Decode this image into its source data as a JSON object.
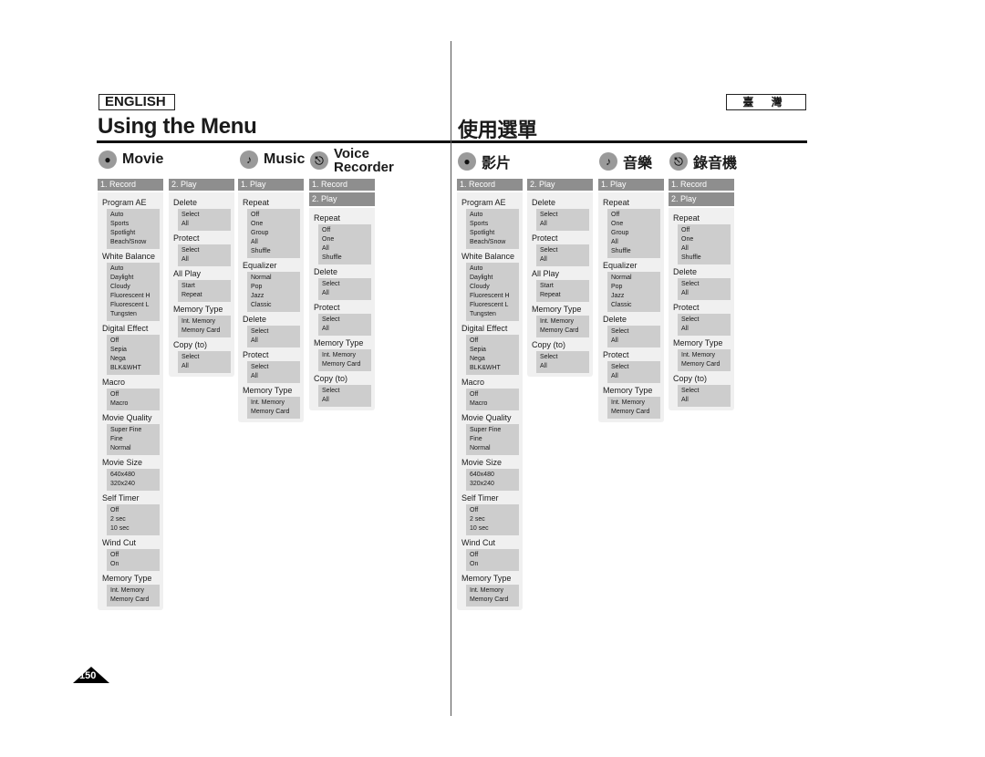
{
  "left": {
    "language_label": "ENGLISH",
    "title": "Using the Menu",
    "categories": [
      {
        "name": "Movie",
        "icon": "camcorder-icon"
      },
      {
        "name": "Music",
        "icon": "music-note-icon"
      },
      {
        "name": "Voice Recorder",
        "icon": "microphone-icon"
      }
    ]
  },
  "right": {
    "language_label": "臺 灣",
    "title": "使用選單",
    "categories": [
      {
        "name": "影片",
        "icon": "camcorder-icon"
      },
      {
        "name": "音樂",
        "icon": "music-note-icon"
      },
      {
        "name": "錄音機",
        "icon": "microphone-icon"
      }
    ]
  },
  "columns": {
    "movie_record": {
      "header": "1. Record",
      "items": [
        {
          "label": "Program AE",
          "options": [
            "Auto",
            "Sports",
            "Spotlight",
            "Beach/Snow"
          ]
        },
        {
          "label": "White Balance",
          "options": [
            "Auto",
            "Daylight",
            "Cloudy",
            "Fluorescent H",
            "Fluorescent L",
            "Tungsten"
          ]
        },
        {
          "label": "Digital Effect",
          "options": [
            "Off",
            "Sepia",
            "Nega",
            "BLK&WHT"
          ]
        },
        {
          "label": "Macro",
          "options": [
            "Off",
            "Macro"
          ]
        },
        {
          "label": "Movie Quality",
          "options": [
            "Super Fine",
            "Fine",
            "Normal"
          ]
        },
        {
          "label": "Movie Size",
          "options": [
            "640x480",
            "320x240"
          ]
        },
        {
          "label": "Self Timer",
          "options": [
            "Off",
            "2 sec",
            "10 sec"
          ]
        },
        {
          "label": "Wind Cut",
          "options": [
            "Off",
            "On"
          ]
        },
        {
          "label": "Memory Type",
          "options": [
            "Int. Memory",
            "Memory Card"
          ]
        }
      ]
    },
    "movie_play": {
      "header": "2. Play",
      "items": [
        {
          "label": "Delete",
          "options": [
            "Select",
            "All"
          ]
        },
        {
          "label": "Protect",
          "options": [
            "Select",
            "All"
          ]
        },
        {
          "label": "All Play",
          "options": [
            "Start",
            "Repeat"
          ]
        },
        {
          "label": "Memory Type",
          "options": [
            "Int. Memory",
            "Memory Card"
          ]
        },
        {
          "label": "Copy (to)",
          "options": [
            "Select",
            "All"
          ]
        }
      ]
    },
    "music_play": {
      "header": "1. Play",
      "items": [
        {
          "label": "Repeat",
          "options": [
            "Off",
            "One",
            "Group",
            "All",
            "Shuffle"
          ]
        },
        {
          "label": "Equalizer",
          "options": [
            "Normal",
            "Pop",
            "Jazz",
            "Classic"
          ]
        },
        {
          "label": "Delete",
          "options": [
            "Select",
            "All"
          ]
        },
        {
          "label": "Protect",
          "options": [
            "Select",
            "All"
          ]
        },
        {
          "label": "Memory Type",
          "options": [
            "Int. Memory",
            "Memory Card"
          ]
        }
      ]
    },
    "voice": {
      "header": "1. Record",
      "sub_header": "2. Play",
      "items": [
        {
          "label": "Repeat",
          "options": [
            "Off",
            "One",
            "All",
            "Shuffle"
          ]
        },
        {
          "label": "Delete",
          "options": [
            "Select",
            "All"
          ]
        },
        {
          "label": "Protect",
          "options": [
            "Select",
            "All"
          ]
        },
        {
          "label": "Memory Type",
          "options": [
            "Int. Memory",
            "Memory Card"
          ]
        },
        {
          "label": "Copy (to)",
          "options": [
            "Select",
            "All"
          ]
        }
      ]
    }
  },
  "page_number": "150"
}
